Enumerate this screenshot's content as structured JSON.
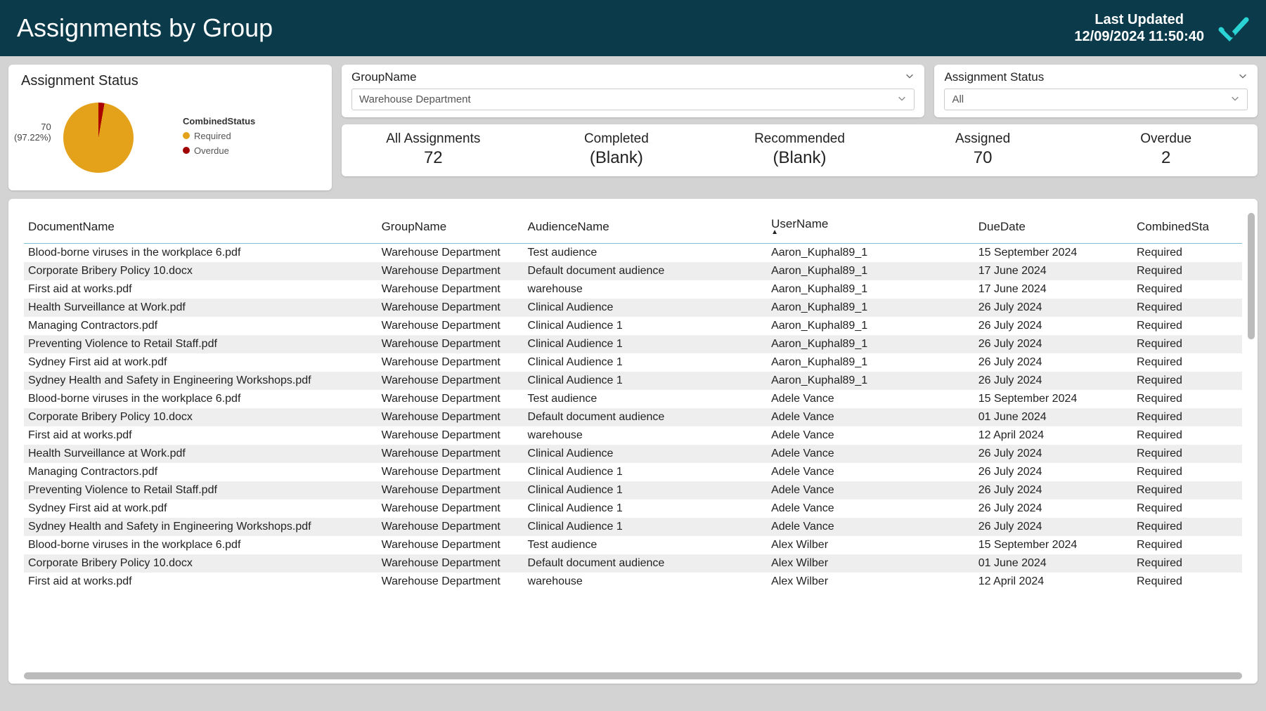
{
  "header": {
    "title": "Assignments by Group",
    "last_updated_label": "Last Updated",
    "last_updated_value": "12/09/2024 11:50:40"
  },
  "status_card": {
    "title": "Assignment Status",
    "legend_title": "CombinedStatus",
    "legend": [
      {
        "label": "Required",
        "color": "#e3a21a"
      },
      {
        "label": "Overdue",
        "color": "#a00000"
      }
    ],
    "callout_value": "70",
    "callout_pct": "(97.22%)"
  },
  "chart_data": {
    "type": "pie",
    "title": "Assignment Status",
    "series": [
      {
        "name": "Required",
        "value": 70,
        "pct": 97.22,
        "color": "#e3a21a"
      },
      {
        "name": "Overdue",
        "value": 2,
        "pct": 2.78,
        "color": "#a00000"
      }
    ]
  },
  "filters": {
    "group": {
      "label": "GroupName",
      "value": "Warehouse Department"
    },
    "status": {
      "label": "Assignment Status",
      "value": "All"
    }
  },
  "metrics": [
    {
      "label": "All Assignments",
      "value": "72"
    },
    {
      "label": "Completed",
      "value": "(Blank)"
    },
    {
      "label": "Recommended",
      "value": "(Blank)"
    },
    {
      "label": "Assigned",
      "value": "70"
    },
    {
      "label": "Overdue",
      "value": "2"
    }
  ],
  "table": {
    "columns": [
      "DocumentName",
      "GroupName",
      "AudienceName",
      "UserName",
      "DueDate",
      "CombinedSta"
    ],
    "sort_column": 3,
    "rows": [
      [
        "Blood-borne viruses in the workplace 6.pdf",
        "Warehouse Department",
        "Test audience",
        "Aaron_Kuphal89_1",
        "15 September 2024",
        "Required"
      ],
      [
        "Corporate Bribery Policy 10.docx",
        "Warehouse Department",
        "Default document audience",
        "Aaron_Kuphal89_1",
        "17 June 2024",
        "Required"
      ],
      [
        "First aid at works.pdf",
        "Warehouse Department",
        "warehouse",
        "Aaron_Kuphal89_1",
        "17 June 2024",
        "Required"
      ],
      [
        "Health Surveillance at Work.pdf",
        "Warehouse Department",
        "Clinical Audience",
        "Aaron_Kuphal89_1",
        "26 July 2024",
        "Required"
      ],
      [
        "Managing Contractors.pdf",
        "Warehouse Department",
        "Clinical Audience 1",
        "Aaron_Kuphal89_1",
        "26 July 2024",
        "Required"
      ],
      [
        "Preventing Violence to Retail Staff.pdf",
        "Warehouse Department",
        "Clinical Audience 1",
        "Aaron_Kuphal89_1",
        "26 July 2024",
        "Required"
      ],
      [
        "Sydney First aid at work.pdf",
        "Warehouse Department",
        "Clinical Audience 1",
        "Aaron_Kuphal89_1",
        "26 July 2024",
        "Required"
      ],
      [
        "Sydney Health and Safety in Engineering Workshops.pdf",
        "Warehouse Department",
        "Clinical Audience 1",
        "Aaron_Kuphal89_1",
        "26 July 2024",
        "Required"
      ],
      [
        "Blood-borne viruses in the workplace 6.pdf",
        "Warehouse Department",
        "Test audience",
        "Adele Vance",
        "15 September 2024",
        "Required"
      ],
      [
        "Corporate Bribery Policy 10.docx",
        "Warehouse Department",
        "Default document audience",
        "Adele Vance",
        "01 June 2024",
        "Required"
      ],
      [
        "First aid at works.pdf",
        "Warehouse Department",
        "warehouse",
        "Adele Vance",
        "12 April 2024",
        "Required"
      ],
      [
        "Health Surveillance at Work.pdf",
        "Warehouse Department",
        "Clinical Audience",
        "Adele Vance",
        "26 July 2024",
        "Required"
      ],
      [
        "Managing Contractors.pdf",
        "Warehouse Department",
        "Clinical Audience 1",
        "Adele Vance",
        "26 July 2024",
        "Required"
      ],
      [
        "Preventing Violence to Retail Staff.pdf",
        "Warehouse Department",
        "Clinical Audience 1",
        "Adele Vance",
        "26 July 2024",
        "Required"
      ],
      [
        "Sydney First aid at work.pdf",
        "Warehouse Department",
        "Clinical Audience 1",
        "Adele Vance",
        "26 July 2024",
        "Required"
      ],
      [
        "Sydney Health and Safety in Engineering Workshops.pdf",
        "Warehouse Department",
        "Clinical Audience 1",
        "Adele Vance",
        "26 July 2024",
        "Required"
      ],
      [
        "Blood-borne viruses in the workplace 6.pdf",
        "Warehouse Department",
        "Test audience",
        "Alex Wilber",
        "15 September 2024",
        "Required"
      ],
      [
        "Corporate Bribery Policy 10.docx",
        "Warehouse Department",
        "Default document audience",
        "Alex Wilber",
        "01 June 2024",
        "Required"
      ],
      [
        "First aid at works.pdf",
        "Warehouse Department",
        "warehouse",
        "Alex Wilber",
        "12 April 2024",
        "Required"
      ]
    ]
  }
}
